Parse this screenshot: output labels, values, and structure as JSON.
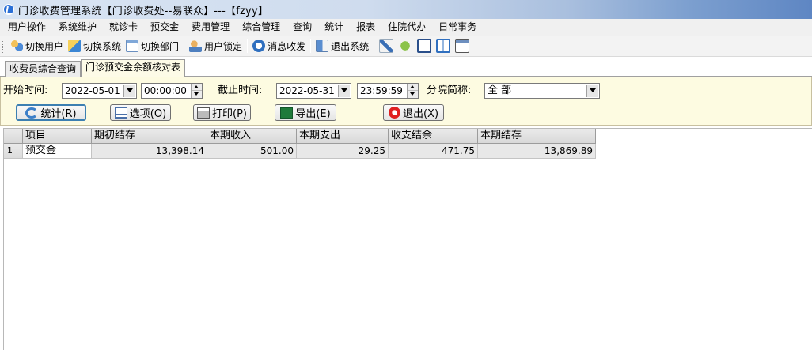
{
  "window": {
    "title": "门诊收费管理系统【门诊收费处--易联众】---【fzyy】"
  },
  "menu": [
    "用户操作",
    "系统维护",
    "就诊卡",
    "预交金",
    "费用管理",
    "综合管理",
    "查询",
    "统计",
    "报表",
    "住院代办",
    "日常事务"
  ],
  "toolbar": {
    "switch_user": "切换用户",
    "switch_system": "切换系统",
    "switch_dept": "切换部门",
    "lock_user": "用户锁定",
    "messages": "消息收发",
    "exit_system": "退出系统"
  },
  "tabs": [
    "收费员综合查询",
    "门诊预交金余额核对表"
  ],
  "filters": {
    "start_label": "开始时间:",
    "start_date": "2022-05-01",
    "start_time": "00:00:00",
    "end_label": "截止时间:",
    "end_date": "2022-05-31",
    "end_time": "23:59:59",
    "branch_label": "分院简称:",
    "branch_value": "全 部"
  },
  "buttons": {
    "stats": "统计(R)",
    "options": "选项(O)",
    "print": "打印(P)",
    "export": "导出(E)",
    "exit": "退出(X)"
  },
  "table": {
    "columns": [
      "",
      "项目",
      "期初结存",
      "本期收入",
      "本期支出",
      "收支结余",
      "本期结存"
    ],
    "rows": [
      {
        "no": "1",
        "item": "预交金",
        "opening": "13,398.14",
        "income": "501.00",
        "expense": "29.25",
        "balance": "471.75",
        "closing": "13,869.89"
      }
    ]
  }
}
